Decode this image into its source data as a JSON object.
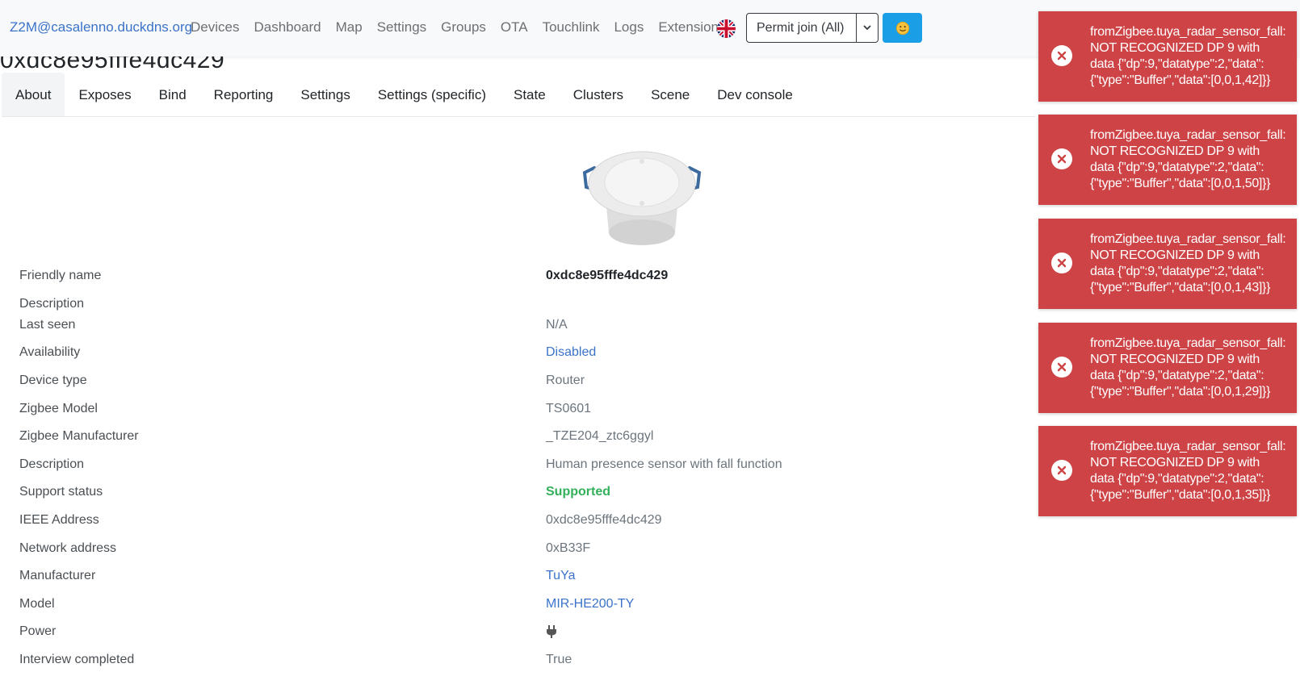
{
  "navbar": {
    "brand": "Z2M@casalenno.duckdns.org",
    "links": [
      "Devices",
      "Dashboard",
      "Map",
      "Settings",
      "Groups",
      "OTA",
      "Touchlink",
      "Logs",
      "Extensions"
    ],
    "language_icon": "uk-flag-icon",
    "permit_join": "Permit join (All)",
    "permit_icon": "chevron-down-icon",
    "theme_icon": "smile-icon",
    "accent": "#1a9ee6"
  },
  "heading": "0xdc8e95fffe4dc429",
  "tabs": [
    "About",
    "Exposes",
    "Bind",
    "Reporting",
    "Settings",
    "Settings (specific)",
    "State",
    "Clusters",
    "Scene",
    "Dev console"
  ],
  "active_tab": "About",
  "device_image_icon": "presence-sensor-image",
  "attributes": [
    {
      "label": "Friendly name",
      "value": "0xdc8e95fffe4dc429",
      "style": "strong"
    },
    {
      "label": "Description",
      "value": "",
      "style": "plain"
    },
    {
      "label": "Last seen",
      "value": "N/A",
      "style": "plain"
    },
    {
      "label": "Availability",
      "value": "Disabled",
      "style": "link"
    },
    {
      "label": "Device type",
      "value": "Router",
      "style": "plain"
    },
    {
      "label": "Zigbee Model",
      "value": "TS0601",
      "style": "plain"
    },
    {
      "label": "Zigbee Manufacturer",
      "value": "_TZE204_ztc6ggyl",
      "style": "plain"
    },
    {
      "label": "Description",
      "value": "Human presence sensor with fall function",
      "style": "plain"
    },
    {
      "label": "Support status",
      "value": "Supported",
      "style": "ok"
    },
    {
      "label": "IEEE Address",
      "value": "0xdc8e95fffe4dc429",
      "style": "plain"
    },
    {
      "label": "Network address",
      "value": "0xB33F",
      "style": "plain"
    },
    {
      "label": "Manufacturer",
      "value": "TuYa",
      "style": "link"
    },
    {
      "label": "Model",
      "value": "MIR-HE200-TY",
      "style": "link"
    },
    {
      "label": "Power",
      "value": "",
      "style": "plain",
      "icon": "plug-icon"
    },
    {
      "label": "Interview completed",
      "value": "True",
      "style": "plain"
    }
  ],
  "toasts": [
    {
      "line1": "fromZigbee.tuya_radar_sensor_fall:",
      "line2": "NOT RECOGNIZED DP 9 with",
      "line3": "data {\"dp\":9,\"datatype\":2,\"data\":",
      "line4": "{\"type\":\"Buffer\",\"data\":[0,0,1,42]}}"
    },
    {
      "line1": "fromZigbee.tuya_radar_sensor_fall:",
      "line2": "NOT RECOGNIZED DP 9 with",
      "line3": "data {\"dp\":9,\"datatype\":2,\"data\":",
      "line4": "{\"type\":\"Buffer\",\"data\":[0,0,1,50]}}"
    },
    {
      "line1": "fromZigbee.tuya_radar_sensor_fall:",
      "line2": "NOT RECOGNIZED DP 9 with",
      "line3": "data {\"dp\":9,\"datatype\":2,\"data\":",
      "line4": "{\"type\":\"Buffer\",\"data\":[0,0,1,43]}}"
    },
    {
      "line1": "fromZigbee.tuya_radar_sensor_fall:",
      "line2": "NOT RECOGNIZED DP 9 with",
      "line3": "data {\"dp\":9,\"datatype\":2,\"data\":",
      "line4": "{\"type\":\"Buffer\",\"data\":[0,0,1,29]}}"
    },
    {
      "line1": "fromZigbee.tuya_radar_sensor_fall:",
      "line2": "NOT RECOGNIZED DP 9 with",
      "line3": "data {\"dp\":9,\"datatype\":2,\"data\":",
      "line4": "{\"type\":\"Buffer\",\"data\":[0,0,1,35]}}"
    }
  ],
  "toast_icon": "error-x-icon",
  "toast_color": "#cd4346"
}
